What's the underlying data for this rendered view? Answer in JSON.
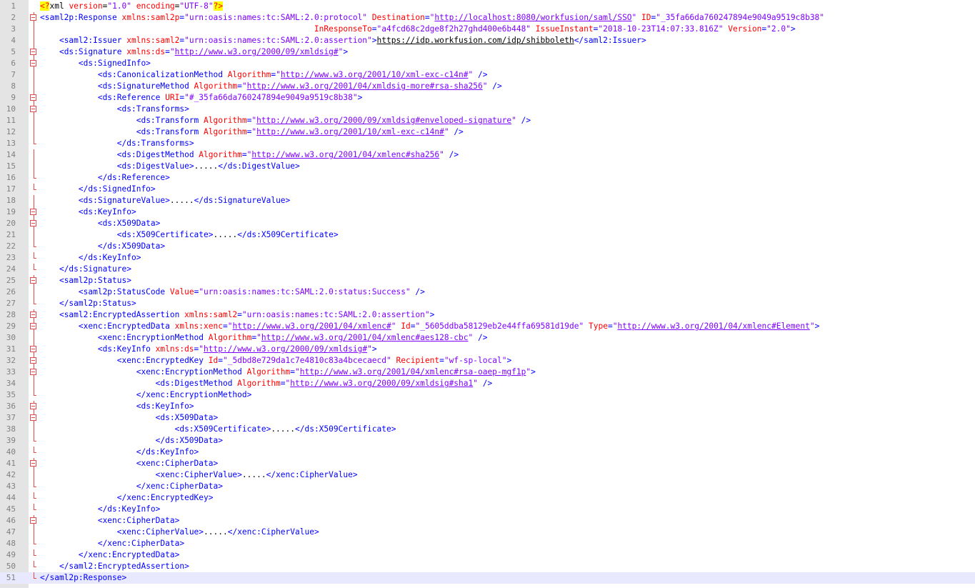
{
  "editor": {
    "language": "XML",
    "current_line": 51,
    "lines": [
      {
        "n": "1",
        "indent": 0,
        "fold": "none",
        "t": [
          [
            "y",
            "<?"
          ],
          [
            "x",
            "xml "
          ],
          [
            "a",
            "version"
          ],
          [
            "x",
            "="
          ],
          [
            "v",
            "\"1.0\""
          ],
          [
            "x",
            " "
          ],
          [
            "a",
            "encoding"
          ],
          [
            "x",
            "="
          ],
          [
            "v",
            "\"UTF-8\""
          ],
          [
            "y",
            "?>"
          ]
        ]
      },
      {
        "n": "2",
        "indent": 0,
        "fold": "start",
        "t": [
          [
            "t",
            "<saml2p:Response "
          ],
          [
            "a",
            "xmlns:saml2p"
          ],
          [
            "t",
            "="
          ],
          [
            "v",
            "\"urn:oasis:names:tc:SAML:2.0:protocol\""
          ],
          [
            "t",
            " "
          ],
          [
            "a",
            "Destination"
          ],
          [
            "t",
            "="
          ],
          [
            "v",
            "\""
          ],
          [
            "u",
            "http://localhost:8080/workfusion/saml/SSO"
          ],
          [
            "v",
            "\""
          ],
          [
            "t",
            " "
          ],
          [
            "a",
            "ID"
          ],
          [
            "t",
            "="
          ],
          [
            "v",
            "\"_35fa66da760247894e9049a9519c8b38\""
          ]
        ]
      },
      {
        "n": "3",
        "indent": 0,
        "fold": "cont",
        "t": [
          [
            "t",
            "                                                         "
          ],
          [
            "a",
            "InResponseTo"
          ],
          [
            "t",
            "="
          ],
          [
            "v",
            "\"a4fcd68c2dge8f2h27ghd400e6b448\""
          ],
          [
            "t",
            " "
          ],
          [
            "a",
            "IssueInstant"
          ],
          [
            "t",
            "="
          ],
          [
            "v",
            "\"2018-10-23T14:07:33.816Z\""
          ],
          [
            "t",
            " "
          ],
          [
            "a",
            "Version"
          ],
          [
            "t",
            "="
          ],
          [
            "v",
            "\"2.0\""
          ],
          [
            "t",
            ">"
          ]
        ]
      },
      {
        "n": "4",
        "indent": 1,
        "fold": "line",
        "t": [
          [
            "t",
            "<saml2:Issuer "
          ],
          [
            "a",
            "xmlns:saml2"
          ],
          [
            "t",
            "="
          ],
          [
            "v",
            "\"urn:oasis:names:tc:SAML:2.0:assertion\""
          ],
          [
            "t",
            ">"
          ],
          [
            "xu",
            "https://idp.workfusion.com/idp/shibboleth"
          ],
          [
            "t",
            "</saml2:Issuer>"
          ]
        ]
      },
      {
        "n": "5",
        "indent": 1,
        "fold": "start",
        "t": [
          [
            "t",
            "<ds:Signature "
          ],
          [
            "a",
            "xmlns:ds"
          ],
          [
            "t",
            "="
          ],
          [
            "v",
            "\""
          ],
          [
            "u",
            "http://www.w3.org/2000/09/xmldsig#"
          ],
          [
            "v",
            "\""
          ],
          [
            "t",
            ">"
          ]
        ]
      },
      {
        "n": "6",
        "indent": 2,
        "fold": "start",
        "t": [
          [
            "t",
            "<ds:SignedInfo>"
          ]
        ]
      },
      {
        "n": "7",
        "indent": 3,
        "fold": "line",
        "t": [
          [
            "t",
            "<ds:CanonicalizationMethod "
          ],
          [
            "a",
            "Algorithm"
          ],
          [
            "t",
            "="
          ],
          [
            "v",
            "\""
          ],
          [
            "u",
            "http://www.w3.org/2001/10/xml-exc-c14n#"
          ],
          [
            "v",
            "\""
          ],
          [
            "t",
            " />"
          ]
        ]
      },
      {
        "n": "8",
        "indent": 3,
        "fold": "line",
        "t": [
          [
            "t",
            "<ds:SignatureMethod "
          ],
          [
            "a",
            "Algorithm"
          ],
          [
            "t",
            "="
          ],
          [
            "v",
            "\""
          ],
          [
            "u",
            "http://www.w3.org/2001/04/xmldsig-more#rsa-sha256"
          ],
          [
            "v",
            "\""
          ],
          [
            "t",
            " />"
          ]
        ]
      },
      {
        "n": "9",
        "indent": 3,
        "fold": "start",
        "t": [
          [
            "t",
            "<ds:Reference "
          ],
          [
            "a",
            "URI"
          ],
          [
            "t",
            "="
          ],
          [
            "v",
            "\"#_35fa66da760247894e9049a9519c8b38\""
          ],
          [
            "t",
            ">"
          ]
        ]
      },
      {
        "n": "10",
        "indent": 4,
        "fold": "start",
        "t": [
          [
            "t",
            "<ds:Transforms>"
          ]
        ]
      },
      {
        "n": "11",
        "indent": 5,
        "fold": "line",
        "t": [
          [
            "t",
            "<ds:Transform "
          ],
          [
            "a",
            "Algorithm"
          ],
          [
            "t",
            "="
          ],
          [
            "v",
            "\""
          ],
          [
            "u",
            "http://www.w3.org/2000/09/xmldsig#enveloped-signature"
          ],
          [
            "v",
            "\""
          ],
          [
            "t",
            " />"
          ]
        ]
      },
      {
        "n": "12",
        "indent": 5,
        "fold": "line",
        "t": [
          [
            "t",
            "<ds:Transform "
          ],
          [
            "a",
            "Algorithm"
          ],
          [
            "t",
            "="
          ],
          [
            "v",
            "\""
          ],
          [
            "u",
            "http://www.w3.org/2001/10/xml-exc-c14n#"
          ],
          [
            "v",
            "\""
          ],
          [
            "t",
            " />"
          ]
        ]
      },
      {
        "n": "13",
        "indent": 4,
        "fold": "end",
        "t": [
          [
            "t",
            "</ds:Transforms>"
          ]
        ]
      },
      {
        "n": "14",
        "indent": 4,
        "fold": "line",
        "t": [
          [
            "t",
            "<ds:DigestMethod "
          ],
          [
            "a",
            "Algorithm"
          ],
          [
            "t",
            "="
          ],
          [
            "v",
            "\""
          ],
          [
            "u",
            "http://www.w3.org/2001/04/xmlenc#sha256"
          ],
          [
            "v",
            "\""
          ],
          [
            "t",
            " />"
          ]
        ]
      },
      {
        "n": "15",
        "indent": 4,
        "fold": "line",
        "t": [
          [
            "t",
            "<ds:DigestValue>"
          ],
          [
            "x",
            "....."
          ],
          [
            "t",
            "</ds:DigestValue>"
          ]
        ]
      },
      {
        "n": "16",
        "indent": 3,
        "fold": "end",
        "t": [
          [
            "t",
            "</ds:Reference>"
          ]
        ]
      },
      {
        "n": "17",
        "indent": 2,
        "fold": "end",
        "t": [
          [
            "t",
            "</ds:SignedInfo>"
          ]
        ]
      },
      {
        "n": "18",
        "indent": 2,
        "fold": "line",
        "t": [
          [
            "t",
            "<ds:SignatureValue>"
          ],
          [
            "x",
            "....."
          ],
          [
            "t",
            "</ds:SignatureValue>"
          ]
        ]
      },
      {
        "n": "19",
        "indent": 2,
        "fold": "start",
        "t": [
          [
            "t",
            "<ds:KeyInfo>"
          ]
        ]
      },
      {
        "n": "20",
        "indent": 3,
        "fold": "start",
        "t": [
          [
            "t",
            "<ds:X509Data>"
          ]
        ]
      },
      {
        "n": "21",
        "indent": 4,
        "fold": "line",
        "t": [
          [
            "t",
            "<ds:X509Certificate>"
          ],
          [
            "x",
            "....."
          ],
          [
            "t",
            "</ds:X509Certificate>"
          ]
        ]
      },
      {
        "n": "22",
        "indent": 3,
        "fold": "end",
        "t": [
          [
            "t",
            "</ds:X509Data>"
          ]
        ]
      },
      {
        "n": "23",
        "indent": 2,
        "fold": "end",
        "t": [
          [
            "t",
            "</ds:KeyInfo>"
          ]
        ]
      },
      {
        "n": "24",
        "indent": 1,
        "fold": "end",
        "t": [
          [
            "t",
            "</ds:Signature>"
          ]
        ]
      },
      {
        "n": "25",
        "indent": 1,
        "fold": "start",
        "t": [
          [
            "t",
            "<saml2p:Status>"
          ]
        ]
      },
      {
        "n": "26",
        "indent": 2,
        "fold": "line",
        "t": [
          [
            "t",
            "<saml2p:StatusCode "
          ],
          [
            "a",
            "Value"
          ],
          [
            "t",
            "="
          ],
          [
            "v",
            "\"urn:oasis:names:tc:SAML:2.0:status:Success\""
          ],
          [
            "t",
            " />"
          ]
        ]
      },
      {
        "n": "27",
        "indent": 1,
        "fold": "end",
        "t": [
          [
            "t",
            "</saml2p:Status>"
          ]
        ]
      },
      {
        "n": "28",
        "indent": 1,
        "fold": "start",
        "t": [
          [
            "t",
            "<saml2:EncryptedAssertion "
          ],
          [
            "a",
            "xmlns:saml2"
          ],
          [
            "t",
            "="
          ],
          [
            "v",
            "\"urn:oasis:names:tc:SAML:2.0:assertion\""
          ],
          [
            "t",
            ">"
          ]
        ]
      },
      {
        "n": "29",
        "indent": 2,
        "fold": "start",
        "t": [
          [
            "t",
            "<xenc:EncryptedData "
          ],
          [
            "a",
            "xmlns:xenc"
          ],
          [
            "t",
            "="
          ],
          [
            "v",
            "\""
          ],
          [
            "u",
            "http://www.w3.org/2001/04/xmlenc#"
          ],
          [
            "v",
            "\""
          ],
          [
            "t",
            " "
          ],
          [
            "a",
            "Id"
          ],
          [
            "t",
            "="
          ],
          [
            "v",
            "\"_5605ddba58129eb2e44ffa69581d19de\""
          ],
          [
            "t",
            " "
          ],
          [
            "a",
            "Type"
          ],
          [
            "t",
            "="
          ],
          [
            "v",
            "\""
          ],
          [
            "u",
            "http://www.w3.org/2001/04/xmlenc#Element"
          ],
          [
            "v",
            "\""
          ],
          [
            "t",
            ">"
          ]
        ]
      },
      {
        "n": "30",
        "indent": 3,
        "fold": "line",
        "t": [
          [
            "t",
            "<xenc:EncryptionMethod "
          ],
          [
            "a",
            "Algorithm"
          ],
          [
            "t",
            "="
          ],
          [
            "v",
            "\""
          ],
          [
            "u",
            "http://www.w3.org/2001/04/xmlenc#aes128-cbc"
          ],
          [
            "v",
            "\""
          ],
          [
            "t",
            " />"
          ]
        ]
      },
      {
        "n": "31",
        "indent": 3,
        "fold": "start",
        "t": [
          [
            "t",
            "<ds:KeyInfo "
          ],
          [
            "a",
            "xmlns:ds"
          ],
          [
            "t",
            "="
          ],
          [
            "v",
            "\""
          ],
          [
            "u",
            "http://www.w3.org/2000/09/xmldsig#"
          ],
          [
            "v",
            "\""
          ],
          [
            "t",
            ">"
          ]
        ]
      },
      {
        "n": "32",
        "indent": 4,
        "fold": "start",
        "t": [
          [
            "t",
            "<xenc:EncryptedKey "
          ],
          [
            "a",
            "Id"
          ],
          [
            "t",
            "="
          ],
          [
            "v",
            "\"_5dbd8e729da1c7e4810c83a4bcecaecd\""
          ],
          [
            "t",
            " "
          ],
          [
            "a",
            "Recipient"
          ],
          [
            "t",
            "="
          ],
          [
            "v",
            "\"wf-sp-local\""
          ],
          [
            "t",
            ">"
          ]
        ]
      },
      {
        "n": "33",
        "indent": 5,
        "fold": "start",
        "t": [
          [
            "t",
            "<xenc:EncryptionMethod "
          ],
          [
            "a",
            "Algorithm"
          ],
          [
            "t",
            "="
          ],
          [
            "v",
            "\""
          ],
          [
            "u",
            "http://www.w3.org/2001/04/xmlenc#rsa-oaep-mgf1p"
          ],
          [
            "v",
            "\""
          ],
          [
            "t",
            ">"
          ]
        ]
      },
      {
        "n": "34",
        "indent": 6,
        "fold": "line",
        "t": [
          [
            "t",
            "<ds:DigestMethod "
          ],
          [
            "a",
            "Algorithm"
          ],
          [
            "t",
            "="
          ],
          [
            "v",
            "\""
          ],
          [
            "u",
            "http://www.w3.org/2000/09/xmldsig#sha1"
          ],
          [
            "v",
            "\""
          ],
          [
            "t",
            " />"
          ]
        ]
      },
      {
        "n": "35",
        "indent": 5,
        "fold": "end",
        "t": [
          [
            "t",
            "</xenc:EncryptionMethod>"
          ]
        ]
      },
      {
        "n": "36",
        "indent": 5,
        "fold": "start",
        "t": [
          [
            "t",
            "<ds:KeyInfo>"
          ]
        ]
      },
      {
        "n": "37",
        "indent": 6,
        "fold": "start",
        "t": [
          [
            "t",
            "<ds:X509Data>"
          ]
        ]
      },
      {
        "n": "38",
        "indent": 7,
        "fold": "line",
        "t": [
          [
            "t",
            "<ds:X509Certificate>"
          ],
          [
            "x",
            "....."
          ],
          [
            "t",
            "</ds:X509Certificate>"
          ]
        ]
      },
      {
        "n": "39",
        "indent": 6,
        "fold": "end",
        "t": [
          [
            "t",
            "</ds:X509Data>"
          ]
        ]
      },
      {
        "n": "40",
        "indent": 5,
        "fold": "end",
        "t": [
          [
            "t",
            "</ds:KeyInfo>"
          ]
        ]
      },
      {
        "n": "41",
        "indent": 5,
        "fold": "start",
        "t": [
          [
            "t",
            "<xenc:CipherData>"
          ]
        ]
      },
      {
        "n": "42",
        "indent": 6,
        "fold": "line",
        "t": [
          [
            "t",
            "<xenc:CipherValue>"
          ],
          [
            "x",
            "....."
          ],
          [
            "t",
            "</xenc:CipherValue>"
          ]
        ]
      },
      {
        "n": "43",
        "indent": 5,
        "fold": "end",
        "t": [
          [
            "t",
            "</xenc:CipherData>"
          ]
        ]
      },
      {
        "n": "44",
        "indent": 4,
        "fold": "end",
        "t": [
          [
            "t",
            "</xenc:EncryptedKey>"
          ]
        ]
      },
      {
        "n": "45",
        "indent": 3,
        "fold": "end",
        "t": [
          [
            "t",
            "</ds:KeyInfo>"
          ]
        ]
      },
      {
        "n": "46",
        "indent": 3,
        "fold": "start",
        "t": [
          [
            "t",
            "<xenc:CipherData>"
          ]
        ]
      },
      {
        "n": "47",
        "indent": 4,
        "fold": "line",
        "t": [
          [
            "t",
            "<xenc:CipherValue>"
          ],
          [
            "x",
            "....."
          ],
          [
            "t",
            "</xenc:CipherValue>"
          ]
        ]
      },
      {
        "n": "48",
        "indent": 3,
        "fold": "end",
        "t": [
          [
            "t",
            "</xenc:CipherData>"
          ]
        ]
      },
      {
        "n": "49",
        "indent": 2,
        "fold": "end",
        "t": [
          [
            "t",
            "</xenc:EncryptedData>"
          ]
        ]
      },
      {
        "n": "50",
        "indent": 1,
        "fold": "end",
        "t": [
          [
            "t",
            "</saml2:EncryptedAssertion>"
          ]
        ]
      },
      {
        "n": "51",
        "indent": 0,
        "fold": "last",
        "t": [
          [
            "t",
            "</saml2p:Response>"
          ]
        ]
      }
    ]
  }
}
